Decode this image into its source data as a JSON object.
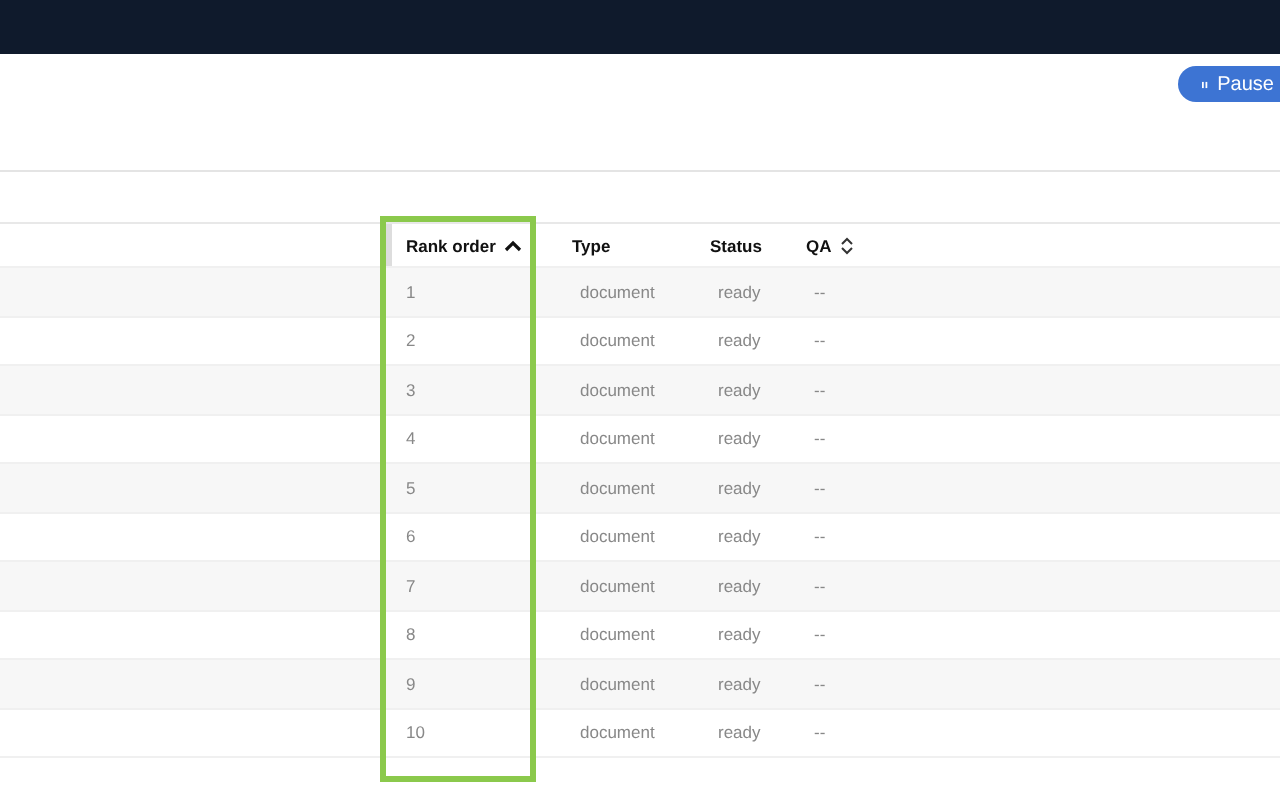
{
  "toolbar": {
    "pause_button": {
      "label": "Pause"
    }
  },
  "table": {
    "columns": [
      {
        "label": "Rank order",
        "sorted": true,
        "highlighted": true
      },
      {
        "label": "Type",
        "sorted": false,
        "sortable": false,
        "highlighted": false
      },
      {
        "label": "Status",
        "sorted": false,
        "sortable": false,
        "highlighted": false
      },
      {
        "label": "QA",
        "sorted": false,
        "sortable": true,
        "highlighted": false
      }
    ],
    "rows": [
      [
        "1",
        "document",
        "ready",
        "--"
      ],
      [
        "2",
        "document",
        "ready",
        "--"
      ],
      [
        "3",
        "document",
        "ready",
        "--"
      ],
      [
        "4",
        "document",
        "ready",
        "--"
      ],
      [
        "5",
        "document",
        "ready",
        "--"
      ],
      [
        "6",
        "document",
        "ready",
        "--"
      ],
      [
        "7",
        "document",
        "ready",
        "--"
      ],
      [
        "8",
        "document",
        "ready",
        "--"
      ],
      [
        "9",
        "document",
        "ready",
        "--"
      ],
      [
        "10",
        "document",
        "ready",
        "--"
      ]
    ]
  }
}
